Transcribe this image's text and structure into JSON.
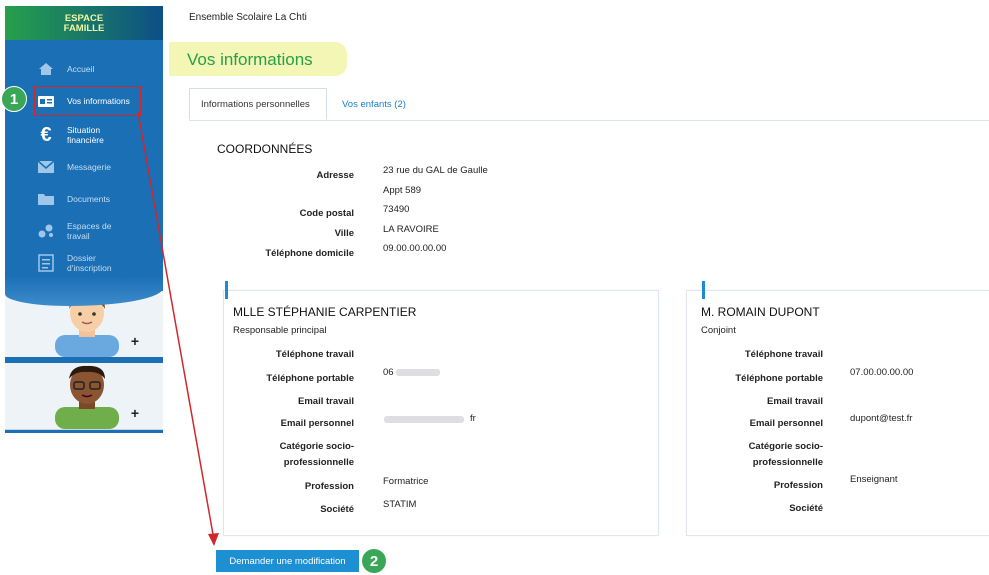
{
  "brand": {
    "line1": "ESPACE",
    "line2": "FAMILLE"
  },
  "sidebar": {
    "items": [
      {
        "label": "Accueil",
        "icon": "home-icon"
      },
      {
        "label": "Vos informations",
        "icon": "id-card-icon"
      },
      {
        "label": "Situation financière",
        "icon": "euro-icon"
      },
      {
        "label": "Messagerie",
        "icon": "envelope-icon"
      },
      {
        "label": "Documents",
        "icon": "folder-icon"
      },
      {
        "label": "Espaces de travail",
        "icon": "workspace-icon"
      },
      {
        "label": "Dossier d'inscription",
        "icon": "document-list-icon"
      }
    ],
    "children_add": "+"
  },
  "steps": {
    "one": "1",
    "two": "2"
  },
  "header": {
    "school": "Ensemble Scolaire La Chti",
    "title": "Vos informations"
  },
  "tabs": [
    {
      "label": "Informations personnelles"
    },
    {
      "label": "Vos enfants (2)"
    }
  ],
  "coordonnees": {
    "title": "COORDONNÉES",
    "adresse_label": "Adresse",
    "adresse_line1": "23 rue du GAL de Gaulle",
    "adresse_line2": "Appt 589",
    "cp_label": "Code postal",
    "cp_value": "73490",
    "ville_label": "Ville",
    "ville_value": "LA RAVOIRE",
    "tel_label": "Téléphone domicile",
    "tel_value": "09.00.00.00.00"
  },
  "labels": {
    "tel_travail": "Téléphone travail",
    "tel_portable": "Téléphone portable",
    "email_travail": "Email travail",
    "email_perso": "Email personnel",
    "categorie1": "Catégorie socio-",
    "categorie2": "professionnelle",
    "profession": "Profession",
    "societe": "Société"
  },
  "person1": {
    "name": "MLLE STÉPHANIE CARPENTIER",
    "role": "Responsable principal",
    "tel_portable": "06",
    "email_perso": "fr",
    "profession": "Formatrice",
    "societe": "STATIM"
  },
  "person2": {
    "name": "M. ROMAIN DUPONT",
    "role": "Conjoint",
    "tel_portable": "07.00.00.00.00",
    "email_perso": "dupont@test.fr",
    "profession": "Enseignant"
  },
  "button": {
    "label": "Demander une modification"
  },
  "colors": {
    "sidebar": "#1a6fb5",
    "accent_green": "#27a048",
    "link": "#1a7fc4",
    "button": "#1d8fd3",
    "highlight": "#d0272d"
  }
}
